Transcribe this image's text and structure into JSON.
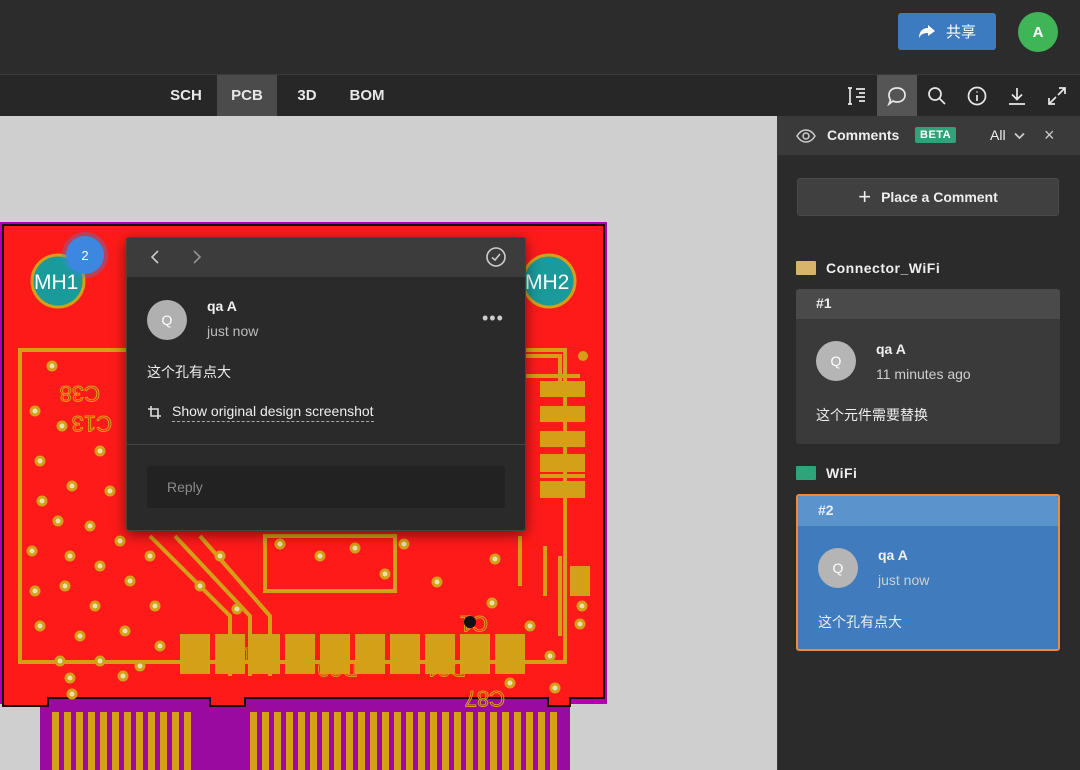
{
  "header": {
    "share_label": "共享",
    "user_initial": "A"
  },
  "tabs": [
    {
      "label": "SCH",
      "active": false
    },
    {
      "label": "PCB",
      "active": true
    },
    {
      "label": "3D",
      "active": false
    },
    {
      "label": "BOM",
      "active": false
    }
  ],
  "toolbar": {
    "icons": [
      "measure-icon",
      "comment-icon",
      "search-icon",
      "info-icon",
      "download-icon",
      "expand-icon"
    ],
    "active_icon": "comment-icon"
  },
  "pcb": {
    "pad_labels": [
      "MH1",
      "MH2"
    ],
    "designators": [
      "C38",
      "C13",
      "C12",
      "D30",
      "D31",
      "C87",
      "C1"
    ]
  },
  "badge": {
    "number": "2"
  },
  "popup": {
    "avatar_initial": "Q",
    "author": "qa A",
    "time": "just now",
    "text": "这个孔有点大",
    "link": "Show original design screenshot",
    "more": "•••",
    "reply_placeholder": "Reply"
  },
  "panel": {
    "title": "Comments",
    "beta": "BETA",
    "filter": "All",
    "close": "×",
    "place_button": "Place a Comment",
    "groups": [
      {
        "name": "Connector_WiFi",
        "icon_color": "#d8b46a",
        "comment": {
          "number": "#1",
          "avatar_initial": "Q",
          "author": "qa A",
          "time": "11 minutes ago",
          "text": "这个元件需要替换"
        }
      },
      {
        "name": "WiFi",
        "icon_color": "#2fa37a",
        "comment": {
          "number": "#2",
          "avatar_initial": "Q",
          "author": "qa A",
          "time": "just now",
          "text": "这个孔有点大",
          "selected": true
        }
      }
    ]
  },
  "colors": {
    "pcb_copper": "#ff1a1a",
    "pcb_trace": "#d4a017",
    "pcb_outline": "#b000b0",
    "accent_blue": "#3d7bc1",
    "selected_border": "#f08a3a"
  }
}
